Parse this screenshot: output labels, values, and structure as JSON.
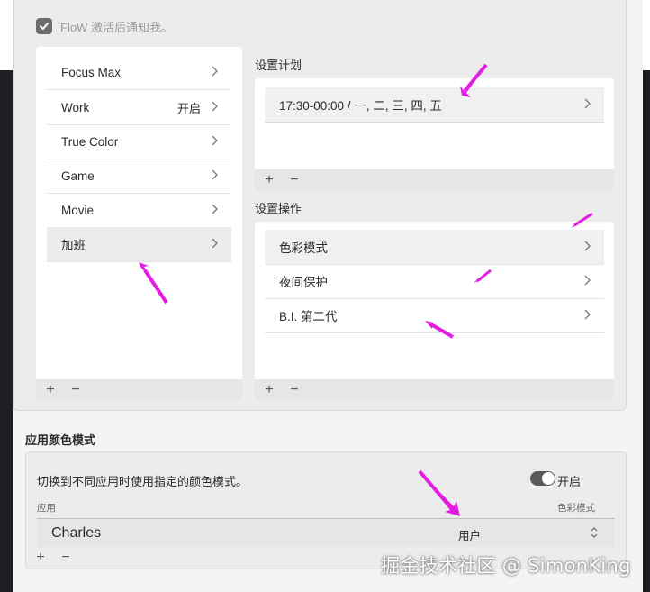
{
  "notify_checkbox": {
    "label": "FloW 激活后通知我。",
    "checked": true
  },
  "profiles": {
    "items": [
      {
        "label": "Focus Max",
        "state": ""
      },
      {
        "label": "Work",
        "state": "开启"
      },
      {
        "label": "True Color",
        "state": ""
      },
      {
        "label": "Game",
        "state": ""
      },
      {
        "label": "Movie",
        "state": ""
      },
      {
        "label": "加班",
        "state": ""
      }
    ],
    "add": "+",
    "remove": "−"
  },
  "schedule": {
    "title": "设置计划",
    "items": [
      {
        "label": "17:30-00:00 / 一, 二, 三, 四, 五"
      }
    ],
    "add": "+",
    "remove": "−"
  },
  "actions": {
    "title": "设置操作",
    "items": [
      {
        "label": "色彩模式"
      },
      {
        "label": "夜间保护"
      },
      {
        "label": "B.I. 第二代"
      }
    ],
    "add": "+",
    "remove": "−"
  },
  "app_color": {
    "title": "应用颜色模式",
    "description": "切换到不同应用时使用指定的颜色模式。",
    "toggle_label": "开启",
    "toggle_on": true,
    "col_app": "应用",
    "col_mode": "色彩模式",
    "rows": [
      {
        "app": "Charles",
        "mode": "用户"
      }
    ],
    "add": "+",
    "remove": "−"
  },
  "watermark": "掘金技术社区 @ SimonKing",
  "colors": {
    "accent_arrow": "#e31ee3",
    "checkbox": "#6d6d6d",
    "toggle": "#5a5a5a"
  },
  "icons": [
    "check-icon",
    "chevron-right-icon",
    "up-down-icon",
    "plus-icon",
    "minus-icon",
    "arrow-annotation"
  ]
}
